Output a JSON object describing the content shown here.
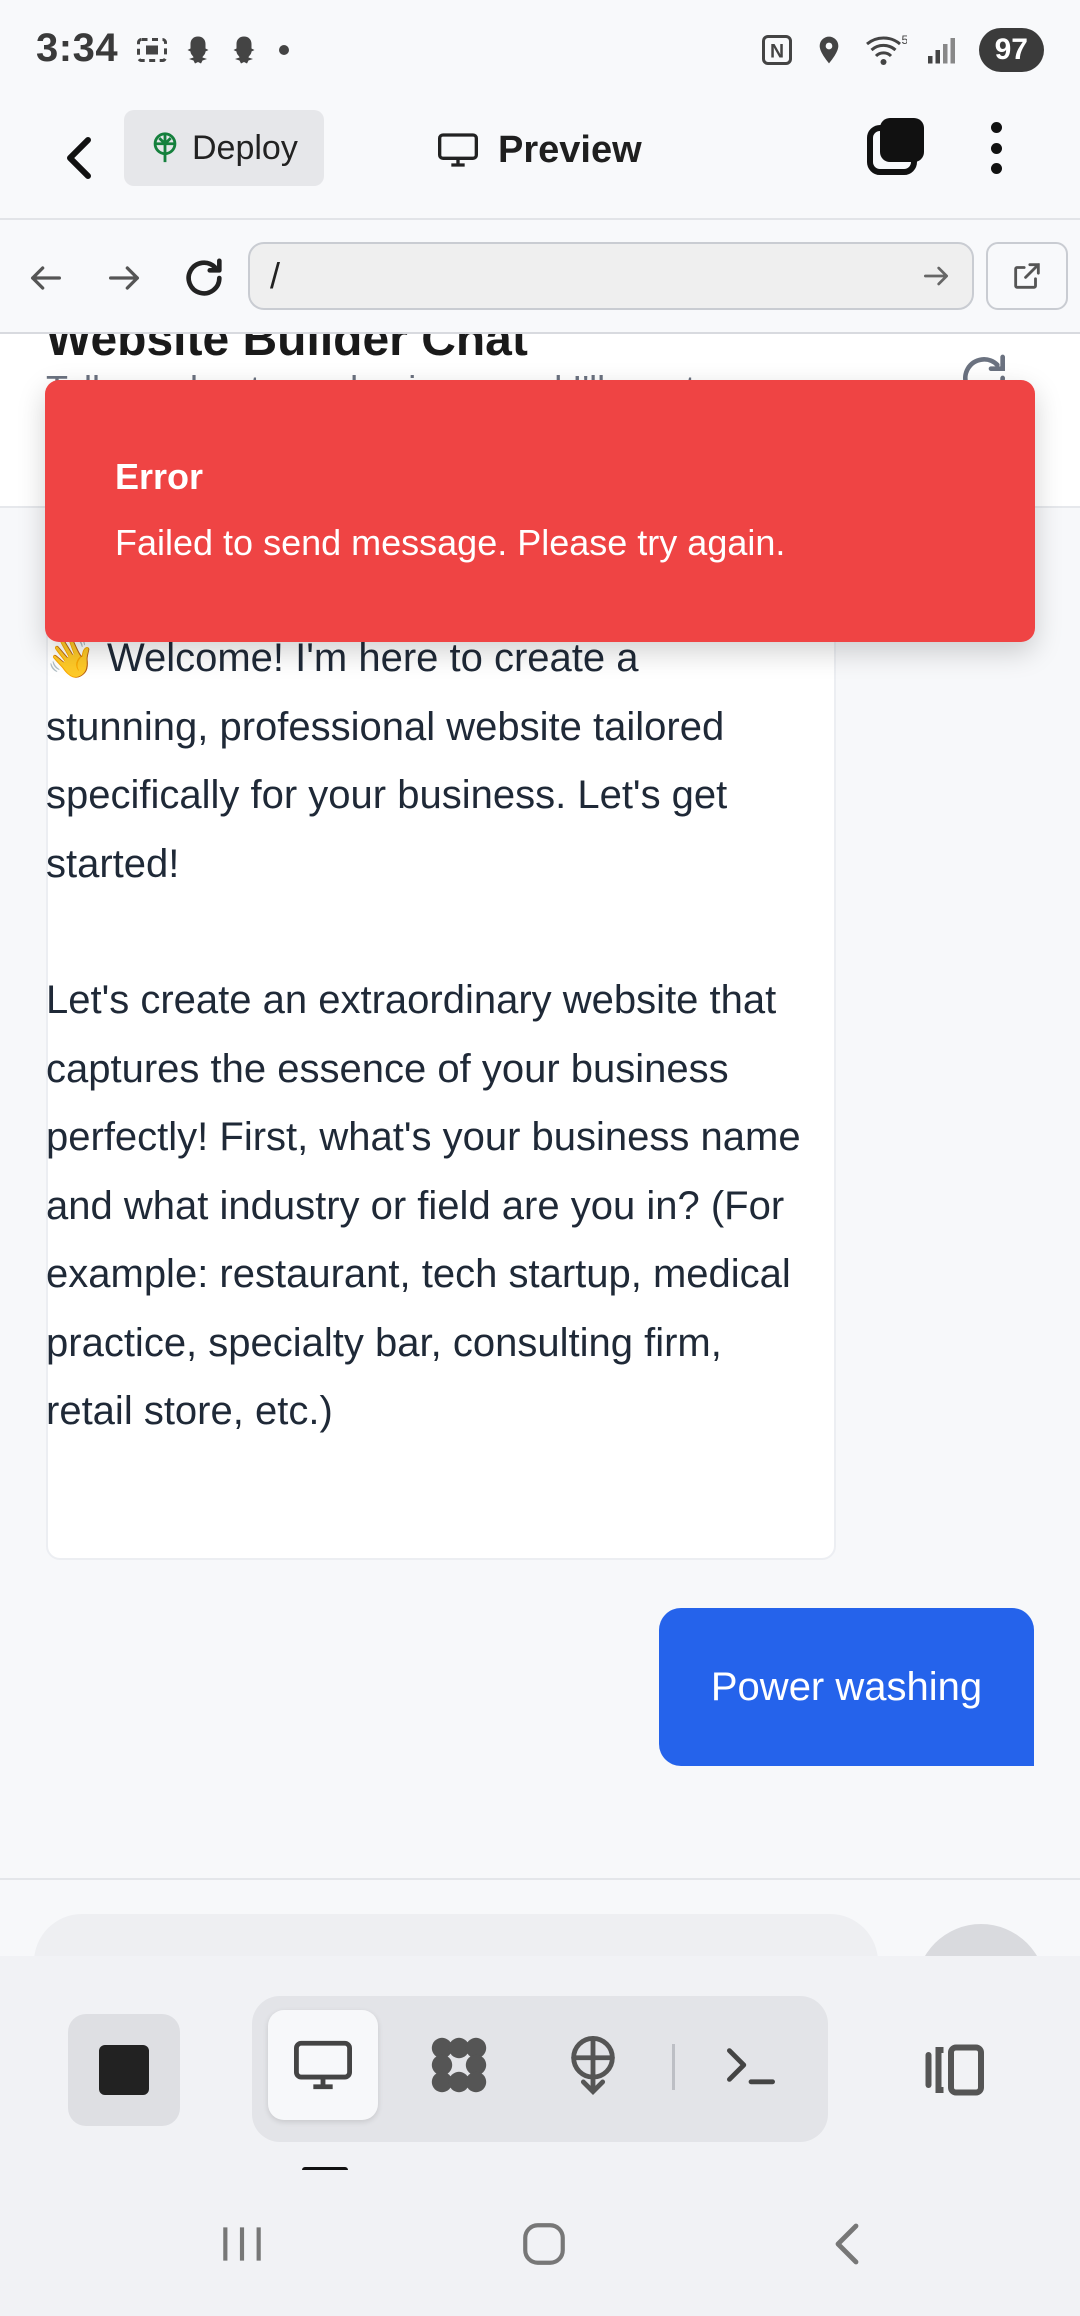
{
  "status_bar": {
    "time": "3:34",
    "network": "5",
    "battery": "97"
  },
  "header": {
    "deploy_label": "Deploy",
    "preview_label": "Preview"
  },
  "browser": {
    "url": "/"
  },
  "page": {
    "title": "Website Builder Chat",
    "subtitle": "Tell me about your business and I'll create"
  },
  "chat": {
    "assistant_paragraphs": [
      "Welcome! I'm here to create a stunning, professional website tailored specifically for your business. Let's get started!",
      "Let's create an extraordinary website that captures the essence of your business perfectly! First, what's your business name and what industry or field are you in? (For example: restaurant, tech startup, medical practice, specialty bar, consulting firm, retail store, etc.)"
    ],
    "assistant_emoji": "👋",
    "user_message": "Power washing"
  },
  "toast": {
    "title": "Error",
    "message": "Failed to send message. Please try again.",
    "color": "#ef4444"
  },
  "dock": {
    "icons": [
      "stop-icon",
      "monitor-icon",
      "apps-icon",
      "deploy-icon",
      "terminal-icon",
      "panel-toggle-icon"
    ],
    "active": "monitor-icon"
  },
  "colors": {
    "accent": "#2563eb",
    "error": "#ef4444"
  }
}
